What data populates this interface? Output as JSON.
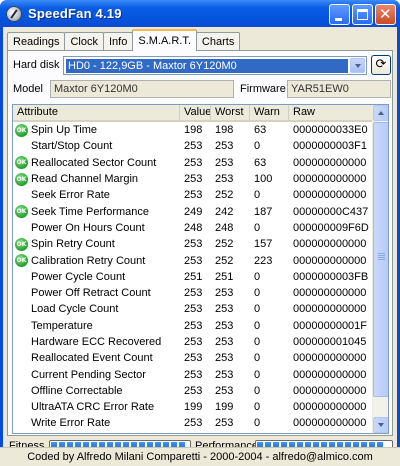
{
  "window": {
    "title": "SpeedFan 4.19"
  },
  "tabs": [
    {
      "label": "Readings"
    },
    {
      "label": "Clock"
    },
    {
      "label": "Info"
    },
    {
      "label": "S.M.A.R.T."
    },
    {
      "label": "Charts"
    }
  ],
  "active_tab": "S.M.A.R.T.",
  "smart": {
    "hard_disk_label": "Hard disk",
    "hard_disk_value": "HD0 - 122,9GB - Maxtor 6Y120M0",
    "model_label": "Model",
    "model_value": "Maxtor 6Y120M0",
    "firmware_label": "Firmware",
    "firmware_value": "YAR51EW0"
  },
  "table": {
    "columns": [
      "Attribute",
      "Value",
      "Worst",
      "Warn",
      "Raw"
    ],
    "rows": [
      {
        "ok": true,
        "attr": "Spin Up Time",
        "value": "198",
        "worst": "198",
        "warn": "63",
        "raw": "0000000033E0"
      },
      {
        "ok": false,
        "attr": "Start/Stop Count",
        "value": "253",
        "worst": "253",
        "warn": "0",
        "raw": "0000000003F1"
      },
      {
        "ok": true,
        "attr": "Reallocated Sector Count",
        "value": "253",
        "worst": "253",
        "warn": "63",
        "raw": "000000000000"
      },
      {
        "ok": true,
        "attr": "Read Channel Margin",
        "value": "253",
        "worst": "253",
        "warn": "100",
        "raw": "000000000000"
      },
      {
        "ok": false,
        "attr": "Seek Error Rate",
        "value": "253",
        "worst": "252",
        "warn": "0",
        "raw": "000000000000"
      },
      {
        "ok": true,
        "attr": "Seek Time Performance",
        "value": "249",
        "worst": "242",
        "warn": "187",
        "raw": "00000000C437"
      },
      {
        "ok": false,
        "attr": "Power On Hours Count",
        "value": "248",
        "worst": "248",
        "warn": "0",
        "raw": "000000009F6D"
      },
      {
        "ok": true,
        "attr": "Spin Retry Count",
        "value": "253",
        "worst": "252",
        "warn": "157",
        "raw": "000000000000"
      },
      {
        "ok": true,
        "attr": "Calibration Retry Count",
        "value": "253",
        "worst": "252",
        "warn": "223",
        "raw": "000000000000"
      },
      {
        "ok": false,
        "attr": "Power Cycle Count",
        "value": "251",
        "worst": "251",
        "warn": "0",
        "raw": "0000000003FB"
      },
      {
        "ok": false,
        "attr": "Power Off Retract Count",
        "value": "253",
        "worst": "253",
        "warn": "0",
        "raw": "000000000000"
      },
      {
        "ok": false,
        "attr": "Load Cycle Count",
        "value": "253",
        "worst": "253",
        "warn": "0",
        "raw": "000000000000"
      },
      {
        "ok": false,
        "attr": "Temperature",
        "value": "253",
        "worst": "253",
        "warn": "0",
        "raw": "00000000001F"
      },
      {
        "ok": false,
        "attr": "Hardware ECC Recovered",
        "value": "253",
        "worst": "253",
        "warn": "0",
        "raw": "000000001045"
      },
      {
        "ok": false,
        "attr": "Reallocated Event Count",
        "value": "253",
        "worst": "253",
        "warn": "0",
        "raw": "000000000000"
      },
      {
        "ok": false,
        "attr": "Current Pending Sector",
        "value": "253",
        "worst": "253",
        "warn": "0",
        "raw": "000000000000"
      },
      {
        "ok": false,
        "attr": "Offline Correctable",
        "value": "253",
        "worst": "253",
        "warn": "0",
        "raw": "000000000000"
      },
      {
        "ok": false,
        "attr": "UltraATA CRC Error Rate",
        "value": "199",
        "worst": "199",
        "warn": "0",
        "raw": "000000000000"
      },
      {
        "ok": false,
        "attr": "Write Error Rate",
        "value": "253",
        "worst": "253",
        "warn": "0",
        "raw": "000000000000"
      }
    ]
  },
  "ok_badge_text": "OK",
  "fitness": {
    "label": "Fitness",
    "level": 1.0
  },
  "performance": {
    "label": "Performance",
    "level": 1.0
  },
  "status": {
    "text": "Coded by Alfredo Milani Comparetti - 2000-2004 - alfredo@almico.com"
  },
  "colors": {
    "titlebar": "#0a4bd6",
    "selection": "#316ac5",
    "ok_green": "#1f9e2a",
    "progress_blue": "#2f7fd8"
  }
}
